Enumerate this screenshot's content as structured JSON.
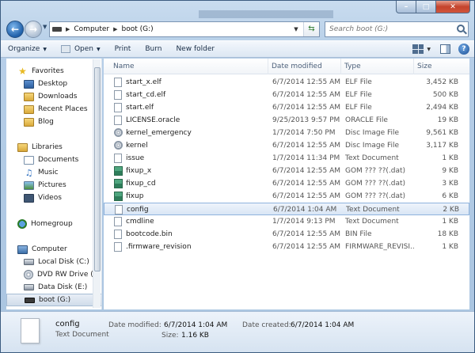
{
  "window": {
    "minimize_label": "–",
    "maximize_label": "□",
    "close_label": "✕"
  },
  "address": {
    "crumbs": [
      "Computer",
      "boot (G:)"
    ],
    "search_placeholder": "Search boot (G:)"
  },
  "toolbar": {
    "organize": "Organize",
    "open": "Open",
    "print": "Print",
    "burn": "Burn",
    "new_folder": "New folder"
  },
  "nav": {
    "favorites": "Favorites",
    "desktop": "Desktop",
    "downloads": "Downloads",
    "recent": "Recent Places",
    "blog": "Blog",
    "libraries": "Libraries",
    "documents": "Documents",
    "music": "Music",
    "pictures": "Pictures",
    "videos": "Videos",
    "homegroup": "Homegroup",
    "computer": "Computer",
    "local_disk": "Local Disk (C:)",
    "dvd": "DVD RW Drive (D",
    "data_disk": "Data Disk (E:)",
    "boot": "boot (G:)"
  },
  "columns": {
    "name": "Name",
    "date": "Date modified",
    "type": "Type",
    "size": "Size"
  },
  "files": [
    {
      "name": "start_x.elf",
      "date": "6/7/2014 12:55 AM",
      "type": "ELF File",
      "size": "3,452 KB",
      "icon": "file"
    },
    {
      "name": "start_cd.elf",
      "date": "6/7/2014 12:55 AM",
      "type": "ELF File",
      "size": "500 KB",
      "icon": "file"
    },
    {
      "name": "start.elf",
      "date": "6/7/2014 12:55 AM",
      "type": "ELF File",
      "size": "2,494 KB",
      "icon": "file"
    },
    {
      "name": "LICENSE.oracle",
      "date": "9/25/2013 9:57 PM",
      "type": "ORACLE File",
      "size": "19 KB",
      "icon": "file"
    },
    {
      "name": "kernel_emergency",
      "date": "1/7/2014 7:50 PM",
      "type": "Disc Image File",
      "size": "9,561 KB",
      "icon": "disc"
    },
    {
      "name": "kernel",
      "date": "6/7/2014 12:55 AM",
      "type": "Disc Image File",
      "size": "3,117 KB",
      "icon": "disc"
    },
    {
      "name": "issue",
      "date": "1/7/2014 11:34 PM",
      "type": "Text Document",
      "size": "1 KB",
      "icon": "file"
    },
    {
      "name": "fixup_x",
      "date": "6/7/2014 12:55 AM",
      "type": "GOM ??? ??(.dat)",
      "size": "9 KB",
      "icon": "dat"
    },
    {
      "name": "fixup_cd",
      "date": "6/7/2014 12:55 AM",
      "type": "GOM ??? ??(.dat)",
      "size": "3 KB",
      "icon": "dat"
    },
    {
      "name": "fixup",
      "date": "6/7/2014 12:55 AM",
      "type": "GOM ??? ??(.dat)",
      "size": "6 KB",
      "icon": "dat"
    },
    {
      "name": "config",
      "date": "6/7/2014 1:04 AM",
      "type": "Text Document",
      "size": "2 KB",
      "icon": "file"
    },
    {
      "name": "cmdline",
      "date": "1/7/2014 9:13 PM",
      "type": "Text Document",
      "size": "1 KB",
      "icon": "file"
    },
    {
      "name": "bootcode.bin",
      "date": "6/7/2014 12:55 AM",
      "type": "BIN File",
      "size": "18 KB",
      "icon": "file"
    },
    {
      "name": ".firmware_revision",
      "date": "6/7/2014 12:55 AM",
      "type": "FIRMWARE_REVISI...",
      "size": "1 KB",
      "icon": "file"
    }
  ],
  "selected_index": 10,
  "details": {
    "name": "config",
    "type": "Text Document",
    "modified_label": "Date modified:",
    "modified_value": "6/7/2014 1:04 AM",
    "created_label": "Date created:",
    "created_value": "6/7/2014 1:04 AM",
    "size_label": "Size:",
    "size_value": "1.16 KB"
  },
  "colors": {
    "accent": "#1f5fa8",
    "selection": "#d9e6f5",
    "close": "#c4432c"
  }
}
